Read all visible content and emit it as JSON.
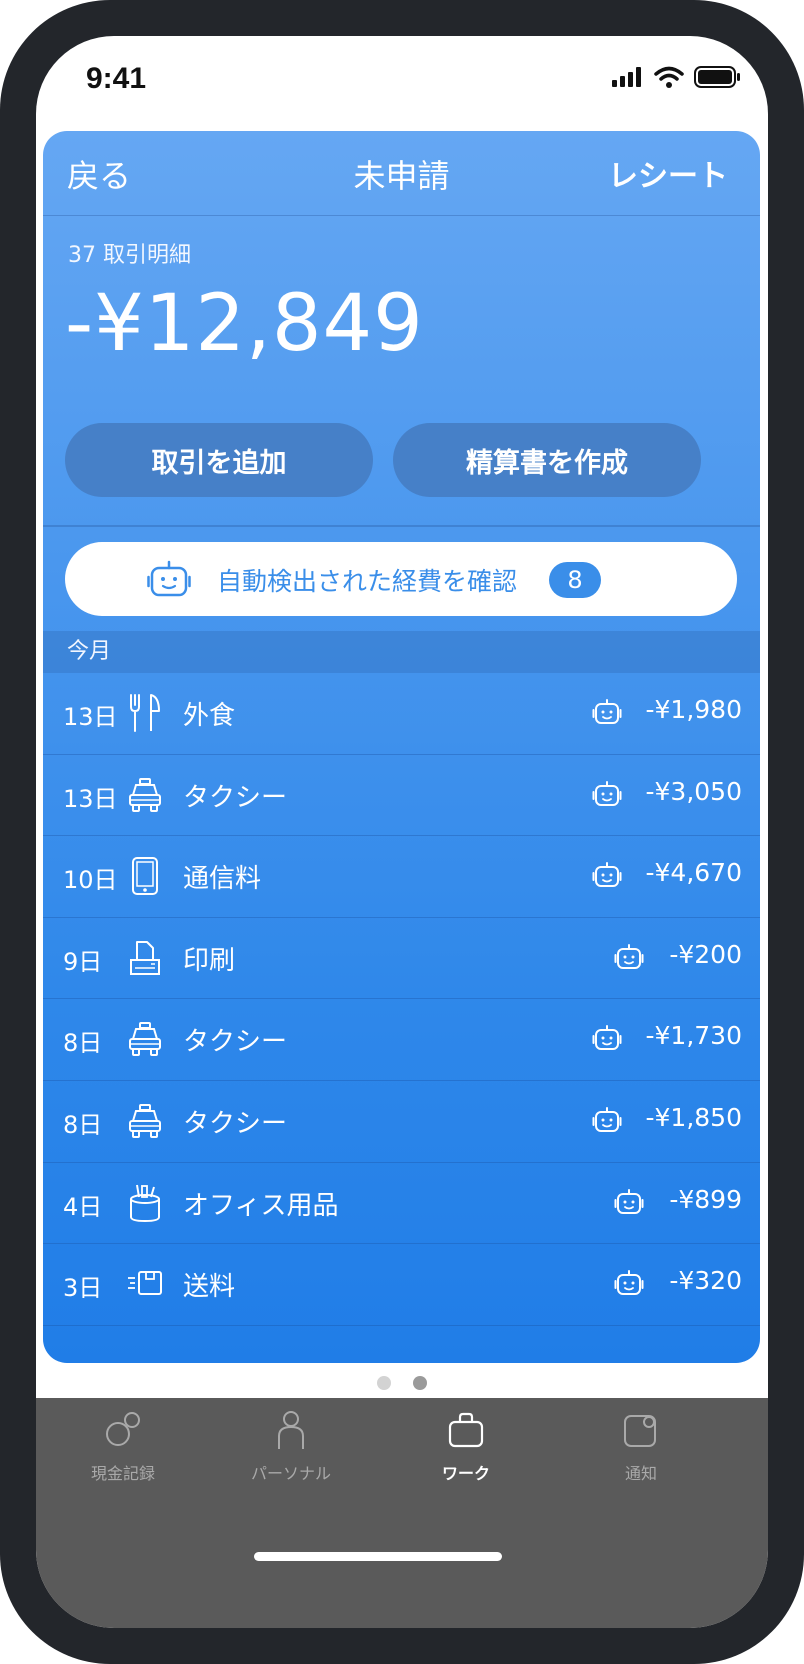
{
  "status_bar": {
    "time": "9:41"
  },
  "nav": {
    "back": "戻る",
    "title": "未申請",
    "receipt": "レシート"
  },
  "summary": {
    "count_label": "37 取引明細",
    "total": "-¥12,849"
  },
  "actions": {
    "add_transaction": "取引を追加",
    "create_report": "精算書を作成"
  },
  "auto_detect": {
    "label": "自動検出された経費を確認",
    "count": "8"
  },
  "section": {
    "title": "今月"
  },
  "transactions": [
    {
      "date": "13日",
      "icon": "utensils-icon",
      "category": "外食",
      "amount": "-¥1,980"
    },
    {
      "date": "13日",
      "icon": "taxi-icon",
      "category": "タクシー",
      "amount": "-¥3,050"
    },
    {
      "date": "10日",
      "icon": "phone-icon",
      "category": "通信料",
      "amount": "-¥4,670"
    },
    {
      "date": "9日",
      "icon": "printer-icon",
      "category": "印刷",
      "amount": "-¥200"
    },
    {
      "date": "8日",
      "icon": "taxi-icon",
      "category": "タクシー",
      "amount": "-¥1,730"
    },
    {
      "date": "8日",
      "icon": "taxi-icon",
      "category": "タクシー",
      "amount": "-¥1,850"
    },
    {
      "date": "4日",
      "icon": "pencil-cup-icon",
      "category": "オフィス用品",
      "amount": "-¥899"
    },
    {
      "date": "3日",
      "icon": "package-icon",
      "category": "送料",
      "amount": "-¥320"
    }
  ],
  "tabs": [
    {
      "label": "現金記録",
      "icon": "cash-icon",
      "active": false
    },
    {
      "label": "パーソナル",
      "icon": "person-icon",
      "active": false
    },
    {
      "label": "ワーク",
      "icon": "briefcase-icon",
      "active": true
    },
    {
      "label": "通知",
      "icon": "notification-icon",
      "active": false
    }
  ],
  "colors": {
    "accent": "#3a8ee9",
    "card_top": "#65a7f3",
    "card_bottom": "#207de7",
    "tabbar": "#5a5a5a"
  }
}
